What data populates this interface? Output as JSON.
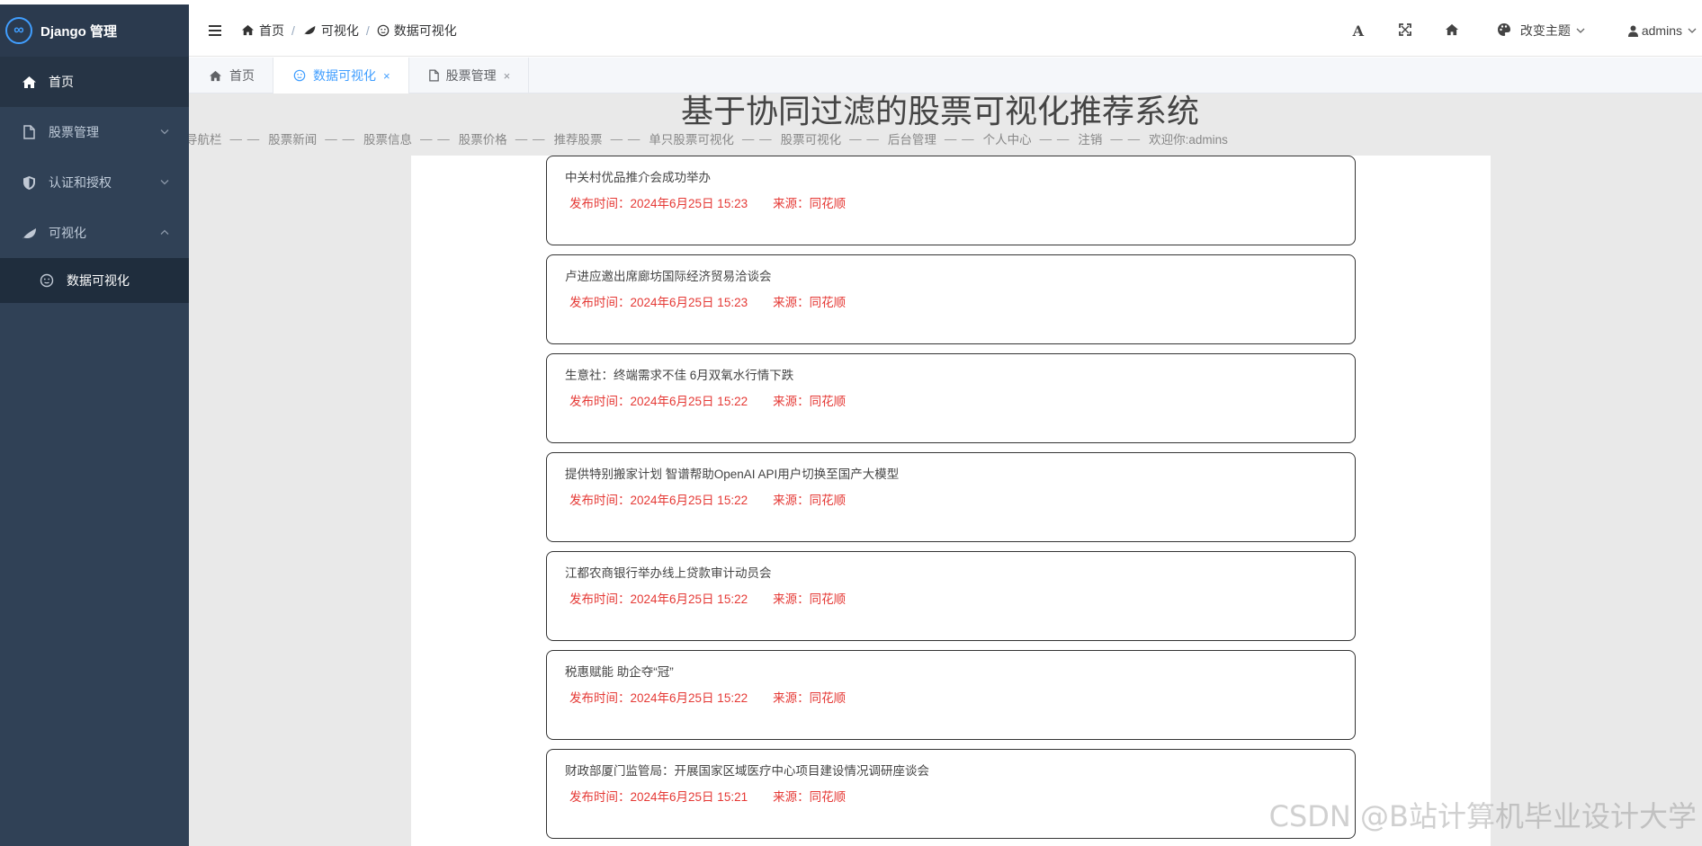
{
  "sidebar": {
    "logo_text": "Django 管理",
    "items": [
      {
        "label": "首页"
      },
      {
        "label": "股票管理"
      },
      {
        "label": "认证和授权"
      },
      {
        "label": "可视化"
      }
    ],
    "subitems": [
      {
        "label": "数据可视化"
      }
    ]
  },
  "header": {
    "breadcrumb": [
      "首页",
      "可视化",
      "数据可视化"
    ],
    "font_label": "A",
    "theme_label": "改变主题",
    "user_label": "admins"
  },
  "tabs": [
    {
      "label": "首页"
    },
    {
      "label": "数据可视化"
    },
    {
      "label": "股票管理"
    }
  ],
  "site": {
    "title": "基于协同过滤的股票可视化推荐系统",
    "separator": "— —",
    "nav": [
      "导航栏",
      "股票新闻",
      "股票信息",
      "股票价格",
      "推荐股票",
      "单只股票可视化",
      "股票可视化",
      "后台管理",
      "个人中心",
      "注销",
      "欢迎你:admins"
    ]
  },
  "news": {
    "time_prefix": "发布时间：",
    "source_prefix": "来源：",
    "items": [
      {
        "title": "中关村优品推介会成功举办",
        "time": "2024年6月25日 15:23",
        "source": "同花顺"
      },
      {
        "title": "卢进应邀出席廊坊国际经济贸易洽谈会",
        "time": "2024年6月25日 15:23",
        "source": "同花顺"
      },
      {
        "title": "生意社：终端需求不佳 6月双氧水行情下跌",
        "time": "2024年6月25日 15:22",
        "source": "同花顺"
      },
      {
        "title": "提供特别搬家计划 智谱帮助OpenAI API用户切换至国产大模型",
        "time": "2024年6月25日 15:22",
        "source": "同花顺"
      },
      {
        "title": "江都农商银行举办线上贷款审计动员会",
        "time": "2024年6月25日 15:22",
        "source": "同花顺"
      },
      {
        "title": "税惠赋能 助企夺“冠”",
        "time": "2024年6月25日 15:22",
        "source": "同花顺"
      },
      {
        "title": "财政部厦门监管局：开展国家区域医疗中心项目建设情况调研座谈会",
        "time": "2024年6月25日 15:21",
        "source": "同花顺"
      }
    ]
  },
  "watermark": "CSDN @B站计算机毕业设计大学",
  "colors": {
    "sidebar_bg": "#304156",
    "accent": "#409eff",
    "meta_red": "#e53935"
  }
}
